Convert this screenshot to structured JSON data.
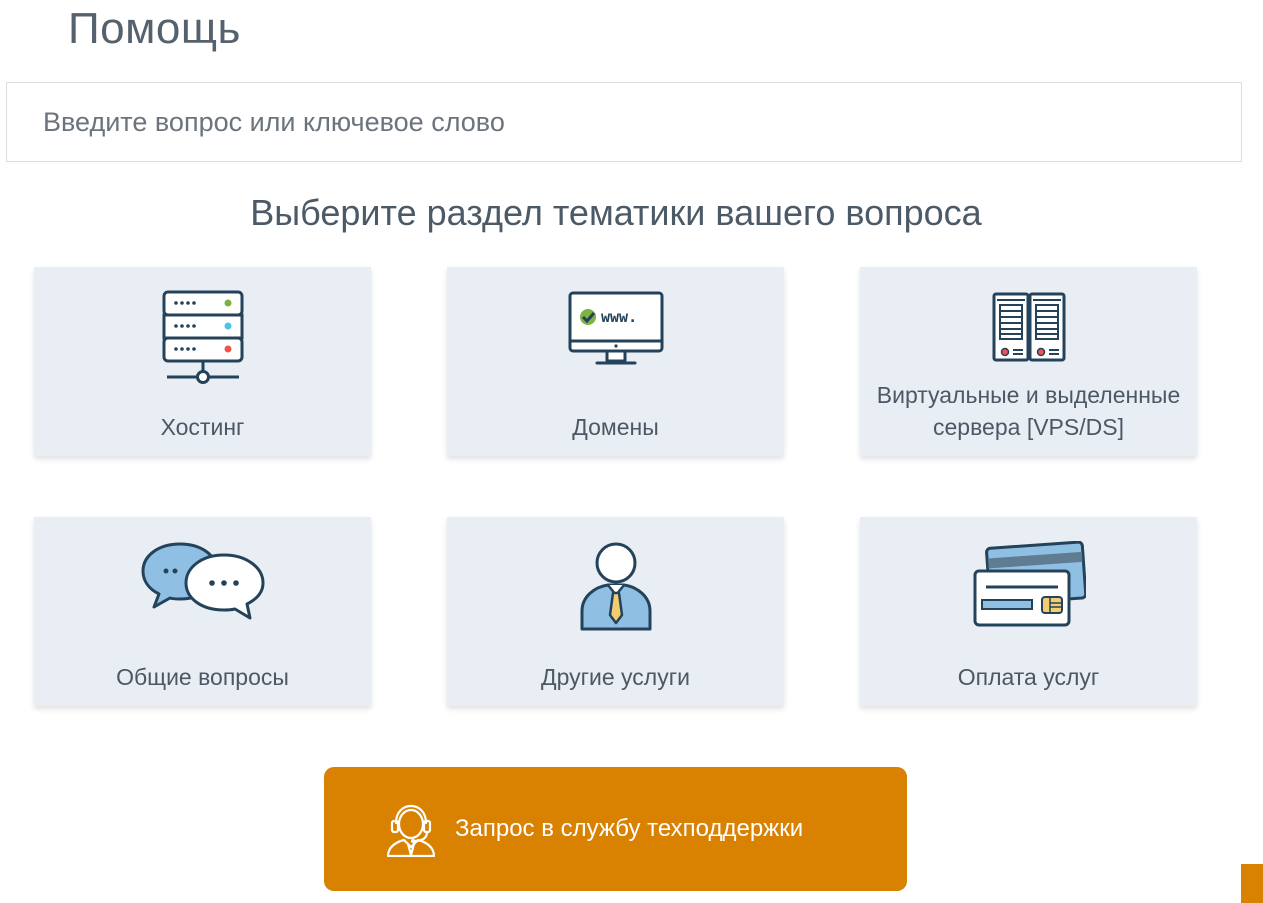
{
  "page": {
    "title": "Помощь"
  },
  "search": {
    "placeholder": "Введите вопрос или ключевое слово"
  },
  "section": {
    "heading": "Выберите раздел тематики вашего вопроса"
  },
  "categories": [
    {
      "label": "Хостинг",
      "icon": "server-rack-icon"
    },
    {
      "label": "Домены",
      "icon": "www-monitor-icon"
    },
    {
      "label_line1": "Виртуальные и выделенные",
      "label_line2": "сервера [VPS/DS]",
      "icon": "server-towers-icon"
    },
    {
      "label": "Общие вопросы",
      "icon": "chat-bubbles-icon"
    },
    {
      "label": "Другие услуги",
      "icon": "person-tie-icon"
    },
    {
      "label": "Оплата услуг",
      "icon": "credit-card-icon"
    }
  ],
  "monitor_text": "www.",
  "support": {
    "label": "Запрос в службу техподдержки",
    "icon": "headset-icon"
  },
  "colors": {
    "accent": "#d98100",
    "card_bg": "#e8eef4",
    "icon_stroke": "#24435a",
    "icon_blue": "#8fbfe3",
    "icon_yellow": "#f4cc72",
    "status_green": "#7cb342",
    "status_cyan": "#4dc3e6",
    "status_red": "#ef5350"
  }
}
